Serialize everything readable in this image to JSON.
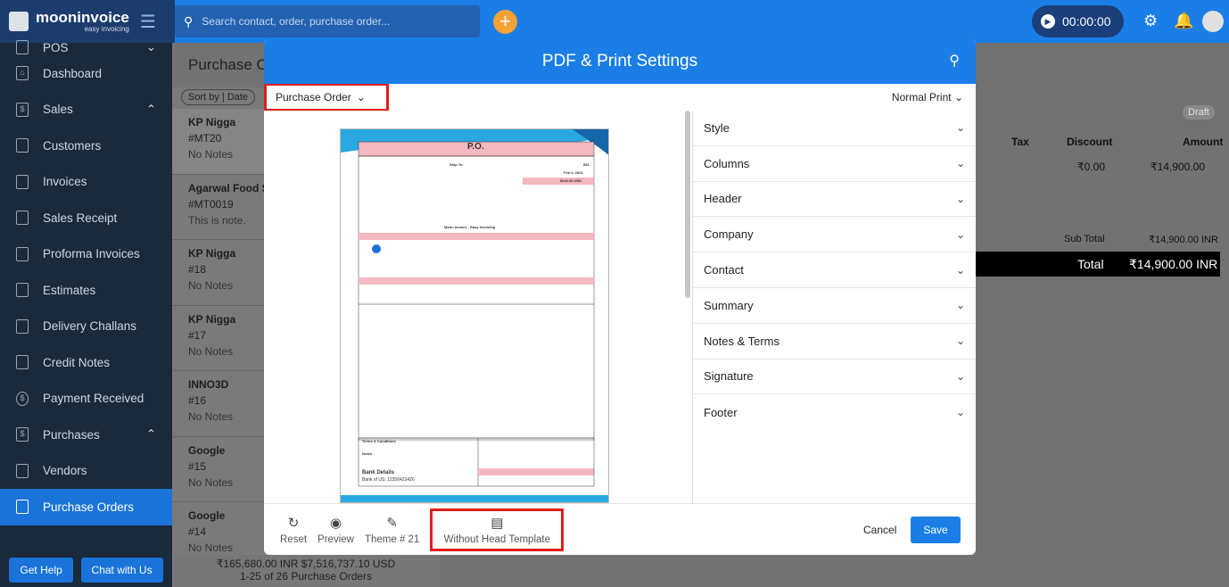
{
  "topbar": {
    "brand": "mooninvoice",
    "tagline": "easy invoicing",
    "search_placeholder": "Search contact, order, purchase order...",
    "timer": "00:00:00"
  },
  "sidebar": {
    "items": [
      {
        "label": "POS",
        "icon": "pos-icon",
        "parent": true
      },
      {
        "label": "Dashboard",
        "icon": "home-icon"
      },
      {
        "label": "Sales",
        "icon": "dollar-icon",
        "parent": true
      },
      {
        "label": "Customers",
        "icon": "contacts-icon"
      },
      {
        "label": "Invoices",
        "icon": "document-icon"
      },
      {
        "label": "Sales Receipt",
        "icon": "receipt-icon"
      },
      {
        "label": "Proforma Invoices",
        "icon": "document-icon"
      },
      {
        "label": "Estimates",
        "icon": "calculator-icon"
      },
      {
        "label": "Delivery Challans",
        "icon": "delivery-icon"
      },
      {
        "label": "Credit Notes",
        "icon": "credit-note-icon"
      },
      {
        "label": "Payment Received",
        "icon": "payment-icon"
      },
      {
        "label": "Purchases",
        "icon": "purchase-icon",
        "parent": true
      },
      {
        "label": "Vendors",
        "icon": "contacts-icon"
      },
      {
        "label": "Purchase Orders",
        "icon": "basket-icon",
        "active": true
      }
    ],
    "get_help": "Get Help",
    "chat": "Chat with Us"
  },
  "list": {
    "title": "Purchase Or",
    "sort": "Sort by | Date",
    "orders": [
      {
        "name": "KP Nigga",
        "num": "#MT20",
        "note": "No Notes"
      },
      {
        "name": "Agarwal Food Se",
        "num": "#MT0019",
        "note": "This is note."
      },
      {
        "name": "KP Nigga",
        "num": "#18",
        "note": "No Notes"
      },
      {
        "name": "KP Nigga",
        "num": "#17",
        "note": "No Notes"
      },
      {
        "name": "INNO3D",
        "num": "#16",
        "note": "No Notes"
      },
      {
        "name": "Google",
        "num": "#15",
        "note": "No Notes"
      },
      {
        "name": "Google",
        "num": "#14",
        "note": "No Notes"
      }
    ],
    "footer_amount": "₹165,680.00 INR $7,516,737.10 USD",
    "footer_count": "1-25 of 26 Purchase Orders"
  },
  "detail": {
    "status": "Draft",
    "tax": "Tax",
    "discount": "Discount",
    "amount": "Amount",
    "discount_value": "₹0.00",
    "amount_value": "₹14,900.00",
    "subtotal_label": "Sub Total",
    "subtotal_value": "₹14,900.00 INR",
    "total_label": "Total",
    "total_value": "₹14,900.00 INR"
  },
  "modal": {
    "title": "PDF & Print Settings",
    "doc_type": "Purchase Order",
    "print_mode": "Normal Print",
    "sections": [
      "Style",
      "Columns",
      "Header",
      "Company",
      "Contact",
      "Summary",
      "Notes & Terms",
      "Signature",
      "Footer"
    ],
    "footer": {
      "reset": "Reset",
      "preview": "Preview",
      "theme": "Theme # 21",
      "template": "Without Head Template",
      "cancel": "Cancel",
      "save": "Save"
    },
    "pdf": {
      "title": "P.O.",
      "company": "Moon Invoice - Easy Invoicing",
      "ship_to": "Ship To:",
      "po_no": "852",
      "date": "Feb 9, 2021",
      "total": "$640.53 USD",
      "terms": "Terms & Conditions",
      "notes": "Notes",
      "bank": "Bank Details",
      "bank_value": "Bank of US: 12356423426"
    }
  }
}
